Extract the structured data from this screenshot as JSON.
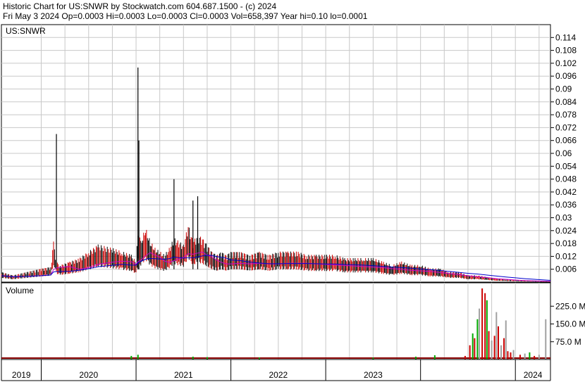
{
  "header": {
    "line1": "Historic Chart for US:SNWR by Stockwatch.com 604.687.1500 - (c) 2024",
    "line2": "Fri May  3 2024   Op=0.0003   Hi=0.0003   Lo=0.0003   Cl=0.0003   Vol=658,397   Year hi=0.10   lo=0.0001"
  },
  "colors": {
    "price": "#000000",
    "down": "#cc0000",
    "ma_short": "#cc00cc",
    "ma_long": "#0000cc",
    "vol_up": "#00aa00",
    "vol_down": "#cc0000",
    "vol_neutral": "#a0a0a0",
    "grid": "#c8c8c8"
  },
  "chart_data": [
    {
      "type": "line",
      "title": "US:SNWR",
      "xlabel": "",
      "ylabel": "",
      "grid": true,
      "ylim": [
        0,
        0.12
      ],
      "y_ticks": [
        0.006,
        0.012,
        0.018,
        0.024,
        0.03,
        0.036,
        0.042,
        0.048,
        0.054,
        0.06,
        0.066,
        0.072,
        0.078,
        0.084,
        0.09,
        0.096,
        0.102,
        0.108,
        0.114
      ],
      "y_tick_labels": [
        "0.006",
        "0.012",
        "0.018",
        "0.024",
        "0.03",
        "0.036",
        "0.042",
        "0.048",
        "0.054",
        "0.06",
        "0.066",
        "0.072",
        "0.078",
        "0.084",
        "0.09",
        "0.096",
        "0.102",
        "0.108",
        "0.114"
      ],
      "x_range": [
        2018.58,
        2024.37
      ],
      "x_labels": [
        {
          "label": "2019",
          "x": 2019.0
        },
        {
          "label": "2020",
          "x": 2020.0
        },
        {
          "label": "2021",
          "x": 2021.0
        },
        {
          "label": "2022",
          "x": 2022.0
        },
        {
          "label": "2023",
          "x": 2023.0
        },
        {
          "label": "2024",
          "x": 2024.0
        }
      ],
      "series": [
        {
          "x": [
            2018.58,
            2018.7,
            2018.85,
            2019.0,
            2019.1,
            2019.13,
            2019.16,
            2019.2,
            2019.3,
            2019.4,
            2019.5,
            2019.6,
            2019.75,
            2019.85,
            2019.95,
            2020.0,
            2020.02,
            2020.05,
            2020.1,
            2020.15,
            2020.2,
            2020.25,
            2020.3,
            2020.35,
            2020.4,
            2020.45,
            2020.5,
            2020.55,
            2020.6,
            2020.65,
            2020.7,
            2020.75,
            2020.8,
            2020.85,
            2020.9,
            2020.95,
            2021.0,
            2021.1,
            2021.2,
            2021.3,
            2021.4,
            2021.5,
            2021.6,
            2021.7,
            2021.8,
            2021.9,
            2022.0,
            2022.1,
            2022.2,
            2022.3,
            2022.4,
            2022.5,
            2022.6,
            2022.7,
            2022.8,
            2022.9,
            2023.0,
            2023.1,
            2023.2,
            2023.3,
            2023.4,
            2023.5,
            2023.6,
            2023.7,
            2023.8,
            2023.9,
            2024.0,
            2024.1,
            2024.2,
            2024.3,
            2024.37
          ],
          "values": [
            0.003,
            0.002,
            0.003,
            0.004,
            0.0045,
            0.012,
            0.006,
            0.005,
            0.006,
            0.007,
            0.009,
            0.011,
            0.01,
            0.009,
            0.008,
            0.006,
            0.015,
            0.012,
            0.016,
            0.012,
            0.01,
            0.009,
            0.008,
            0.01,
            0.013,
            0.012,
            0.011,
            0.017,
            0.012,
            0.014,
            0.013,
            0.011,
            0.009,
            0.008,
            0.009,
            0.008,
            0.009,
            0.009,
            0.008,
            0.009,
            0.008,
            0.009,
            0.009,
            0.009,
            0.008,
            0.008,
            0.008,
            0.008,
            0.007,
            0.007,
            0.007,
            0.007,
            0.006,
            0.005,
            0.006,
            0.005,
            0.005,
            0.004,
            0.004,
            0.003,
            0.003,
            0.002,
            0.002,
            0.0015,
            0.001,
            0.0008,
            0.0006,
            0.0005,
            0.0004,
            0.0003,
            0.0003
          ]
        }
      ]
    },
    {
      "type": "bar",
      "title": "Volume",
      "ylim": [
        0,
        300
      ],
      "y_ticks": [
        75,
        150,
        225
      ],
      "y_tick_labels": [
        "75.0 M",
        "150.0 M",
        "225.0 M"
      ],
      "x": [
        2019.95,
        2020.02,
        2020.6,
        2020.75,
        2021.3,
        2022.5,
        2022.95,
        2023.15,
        2023.47,
        2023.52,
        2023.55,
        2023.57,
        2023.6,
        2023.62,
        2023.65,
        2023.68,
        2023.7,
        2023.72,
        2023.75,
        2023.78,
        2023.8,
        2023.82,
        2023.85,
        2023.88,
        2023.9,
        2023.92,
        2023.95,
        2023.98,
        2024.05,
        2024.1,
        2024.15,
        2024.2,
        2024.25,
        2024.32
      ],
      "values": [
        15,
        20,
        12,
        10,
        8,
        8,
        12,
        18,
        15,
        60,
        110,
        90,
        170,
        215,
        300,
        280,
        250,
        120,
        80,
        100,
        200,
        140,
        60,
        90,
        165,
        35,
        30,
        40,
        20,
        25,
        30,
        15,
        20,
        170
      ],
      "colors": [
        "g",
        "g",
        "g",
        "g",
        "g",
        "g",
        "g",
        "g",
        "r",
        "r",
        "g",
        "r",
        "g",
        "n",
        "r",
        "r",
        "g",
        "r",
        "n",
        "r",
        "n",
        "r",
        "n",
        "r",
        "n",
        "r",
        "r",
        "n",
        "r",
        "n",
        "g",
        "r",
        "n",
        "n"
      ]
    }
  ]
}
